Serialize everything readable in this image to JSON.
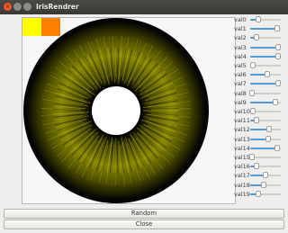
{
  "window": {
    "title": "IrisRendrer",
    "close_glyph": "×"
  },
  "swatches": [
    {
      "name": "yellow",
      "color": "#ffff00"
    },
    {
      "name": "orange",
      "color": "#ff8000"
    }
  ],
  "iris": {
    "pupil_color": "#ffffff",
    "iris_color": "#8a8a00",
    "outer_color": "#050505"
  },
  "sliders": [
    {
      "label": "val0",
      "value": 0.25
    },
    {
      "label": "val1",
      "value": 0.88
    },
    {
      "label": "val2",
      "value": 0.22
    },
    {
      "label": "val3",
      "value": 0.9
    },
    {
      "label": "val4",
      "value": 0.9
    },
    {
      "label": "val5",
      "value": 0.1
    },
    {
      "label": "val6",
      "value": 0.55
    },
    {
      "label": "val7",
      "value": 0.92
    },
    {
      "label": "val8",
      "value": 0.05
    },
    {
      "label": "val9",
      "value": 0.82
    },
    {
      "label": "val10",
      "value": 0.1
    },
    {
      "label": "val11",
      "value": 0.22
    },
    {
      "label": "val12",
      "value": 0.62
    },
    {
      "label": "val13",
      "value": 0.58
    },
    {
      "label": "val14",
      "value": 0.88
    },
    {
      "label": "val15",
      "value": 0.05
    },
    {
      "label": "val16",
      "value": 0.2
    },
    {
      "label": "val17",
      "value": 0.5
    },
    {
      "label": "val18",
      "value": 0.45
    },
    {
      "label": "val19",
      "value": 0.25
    }
  ],
  "buttons": {
    "random": "Random",
    "close": "Close"
  }
}
